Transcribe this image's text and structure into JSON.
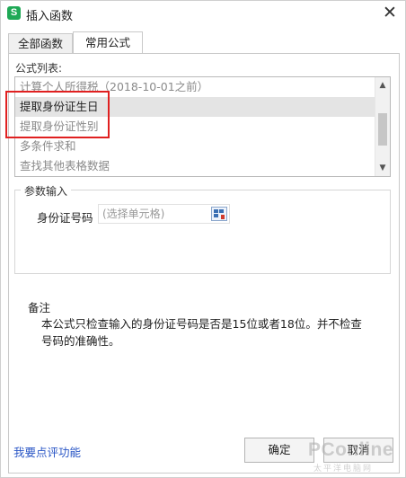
{
  "window": {
    "app_icon_letter": "S",
    "title": "插入函数",
    "close_glyph": "✕"
  },
  "tabs": [
    {
      "label": "全部函数",
      "active": false
    },
    {
      "label": "常用公式",
      "active": true
    }
  ],
  "formula_list": {
    "label": "公式列表:",
    "items": [
      {
        "text": "计算个人所得税（2018-10-01之前）",
        "selected": false
      },
      {
        "text": "提取身份证生日",
        "selected": true
      },
      {
        "text": "提取身份证性别",
        "selected": false
      },
      {
        "text": "多条件求和",
        "selected": false
      },
      {
        "text": "查找其他表格数据",
        "selected": false
      }
    ],
    "scroll_up_glyph": "▲",
    "scroll_down_glyph": "▼"
  },
  "params": {
    "group_title": "参数输入",
    "field_label": "身份证号码",
    "field_placeholder": "(选择单元格)"
  },
  "notes": {
    "title": "备注",
    "body": "本公式只检查输入的身份证号码是否是15位或者18位。并不检查号码的准确性。"
  },
  "footer": {
    "feedback_link": "我要点评功能",
    "ok_label": "确定",
    "cancel_label": "取消"
  },
  "watermark": {
    "text": "PConline",
    "subtext": "太平洋电脑网"
  },
  "colors": {
    "accent_green": "#1fa956",
    "highlight_red": "#e02020",
    "link_blue": "#2a56c6"
  }
}
